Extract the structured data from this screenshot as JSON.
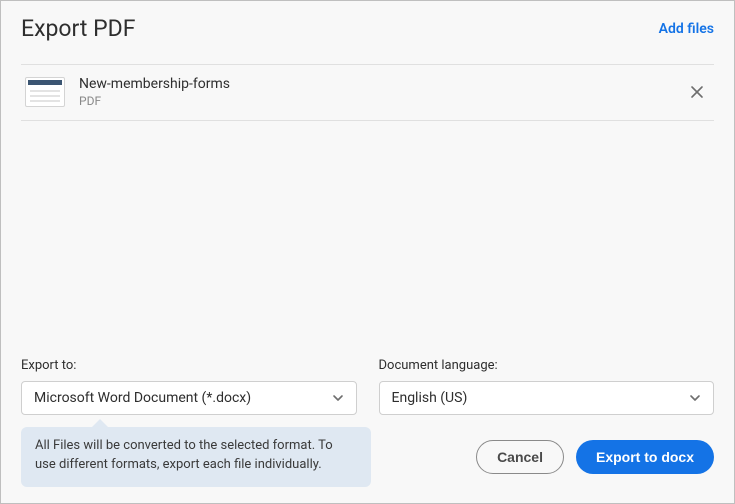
{
  "header": {
    "title": "Export PDF",
    "add_files": "Add files"
  },
  "files": [
    {
      "name": "New-membership-forms",
      "type": "PDF"
    }
  ],
  "export_to": {
    "label": "Export to:",
    "value": "Microsoft Word Document (*.docx)"
  },
  "language": {
    "label": "Document language:",
    "value": "English (US)"
  },
  "tooltip": "All Files will be converted to the selected format. To use different formats, export each file individually.",
  "buttons": {
    "cancel": "Cancel",
    "export": "Export to docx"
  }
}
